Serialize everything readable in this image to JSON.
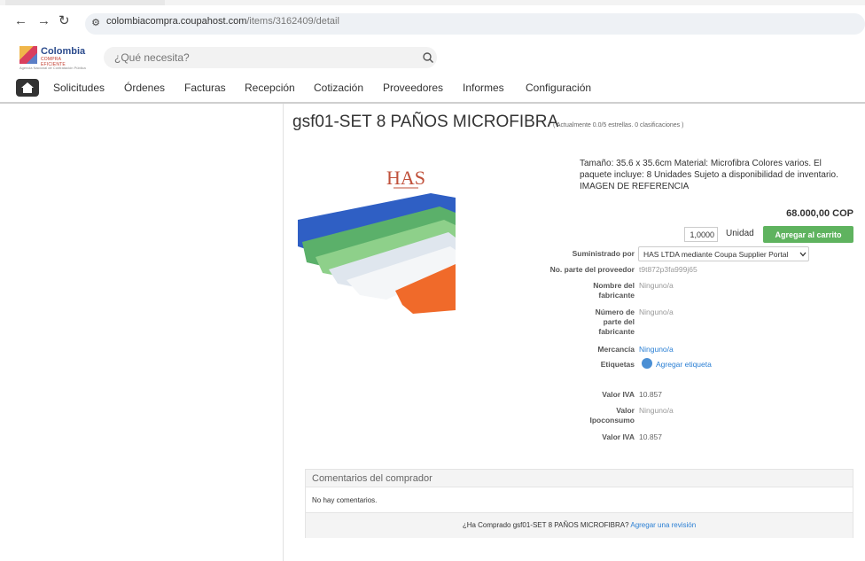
{
  "browser": {
    "back": "←",
    "forward": "→",
    "reload": "↻",
    "url_host": "colombiacompra.coupahost.com",
    "url_path": "/items/3162409/detail"
  },
  "header": {
    "logo_text": "Colombia",
    "logo_sub": "COMPRA EFICIENTE",
    "logo_sub2": "Agencia Nacional de Contratación Pública",
    "search_placeholder": "¿Qué necesita?"
  },
  "nav": {
    "items": [
      "Solicitudes",
      "Órdenes",
      "Facturas",
      "Recepción",
      "Cotización",
      "Proveedores",
      "Informes",
      "Configuración"
    ]
  },
  "product": {
    "title": "gsf01-SET 8 PAÑOS MICROFIBRA",
    "rating": "( Actualmente 0.0/5 estrellas. 0 clasificaciones )",
    "description": "Tamaño: 35.6 x 35.6cm Material: Microfibra Colores varios. El paquete incluye: 8 Unidades Sujeto a disponibilidad de inventario. IMAGEN DE REFERENCIA",
    "price": "68.000,00 COP",
    "quantity": "1,0000",
    "unit": "Unidad",
    "add_to_cart": "Agregar al carrito",
    "image_brand": "HAS"
  },
  "details": {
    "supplied_by_label": "Suministrado por",
    "supplied_by_value": "HAS LTDA mediante Coupa Supplier Portal",
    "part_no_label": "No. parte del proveedor",
    "part_no_value": "t9t872p3fa999j65",
    "mfr_name_label": "Nombre del fabricante",
    "mfr_name_value": "Ninguno/a",
    "mfr_part_label": "Número de parte del fabricante",
    "mfr_part_value": "Ninguno/a",
    "commodity_label": "Mercancía",
    "commodity_value": "Ninguno/a",
    "tags_label": "Etiquetas",
    "tags_value": "Agregar etiqueta",
    "vat_label": "Valor IVA",
    "vat_value": "10.857",
    "ipo_label": "Valor Ipoconsumo",
    "ipo_value": "Ninguno/a",
    "vat2_label": "Valor IVA",
    "vat2_value": "10.857"
  },
  "comments": {
    "title": "Comentarios del comprador",
    "none": "No hay comentarios.",
    "footer_text": "¿Ha Comprado gsf01-SET 8 PAÑOS MICROFIBRA?",
    "footer_link": "Agregar una revisión"
  }
}
